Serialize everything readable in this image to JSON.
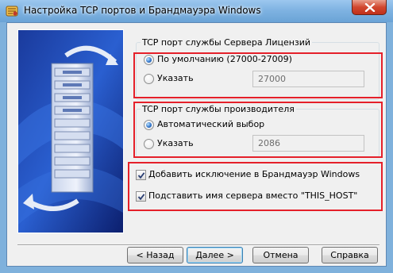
{
  "window": {
    "title": "Настройка TCP портов и Брандмауэра Windows",
    "close_icon": "close-icon",
    "app_icon": "installer-icon"
  },
  "license_server_port": {
    "group_label": "TCP порт службы Сервера Лицензий",
    "default_option": "По умолчанию (27000-27009)",
    "specify_option": "Указать",
    "selected": "default",
    "port_value": "27000"
  },
  "vendor_port": {
    "group_label": "TCP порт службы производителя",
    "auto_option": "Автоматический выбор",
    "specify_option": "Указать",
    "selected": "auto",
    "port_value": "2086"
  },
  "options": {
    "firewall_exception": "Добавить исключение в Брандмауэр Windows",
    "firewall_checked": true,
    "replace_host": "Подставить имя сервера вместо \"THIS_HOST\"",
    "replace_checked": true
  },
  "buttons": {
    "back": "< Назад",
    "next": "Далее >",
    "cancel": "Отмена",
    "help": "Справка"
  },
  "colors": {
    "highlight": "#e5202a",
    "accent": "#2e72c8"
  }
}
